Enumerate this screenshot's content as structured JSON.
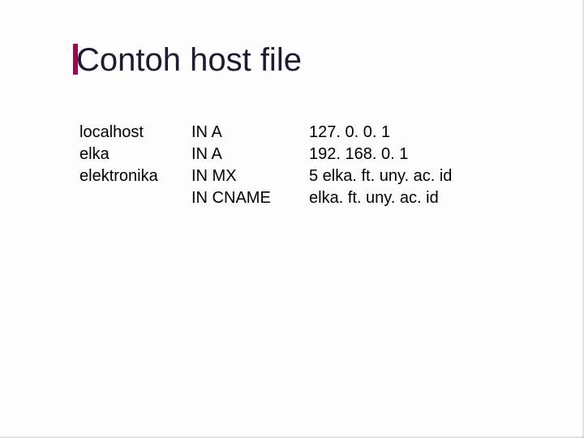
{
  "title": "Contoh host file",
  "rows": [
    {
      "host": "localhost",
      "record": "IN A",
      "value": "127. 0. 0. 1"
    },
    {
      "host": "elka",
      "record": "IN A",
      "value": "192. 168. 0. 1"
    },
    {
      "host": "",
      "record": "IN MX",
      "value": "5 elka. ft. uny. ac. id"
    },
    {
      "host": "elektronika",
      "record": "IN CNAME",
      "value": "elka. ft. uny. ac. id"
    }
  ]
}
